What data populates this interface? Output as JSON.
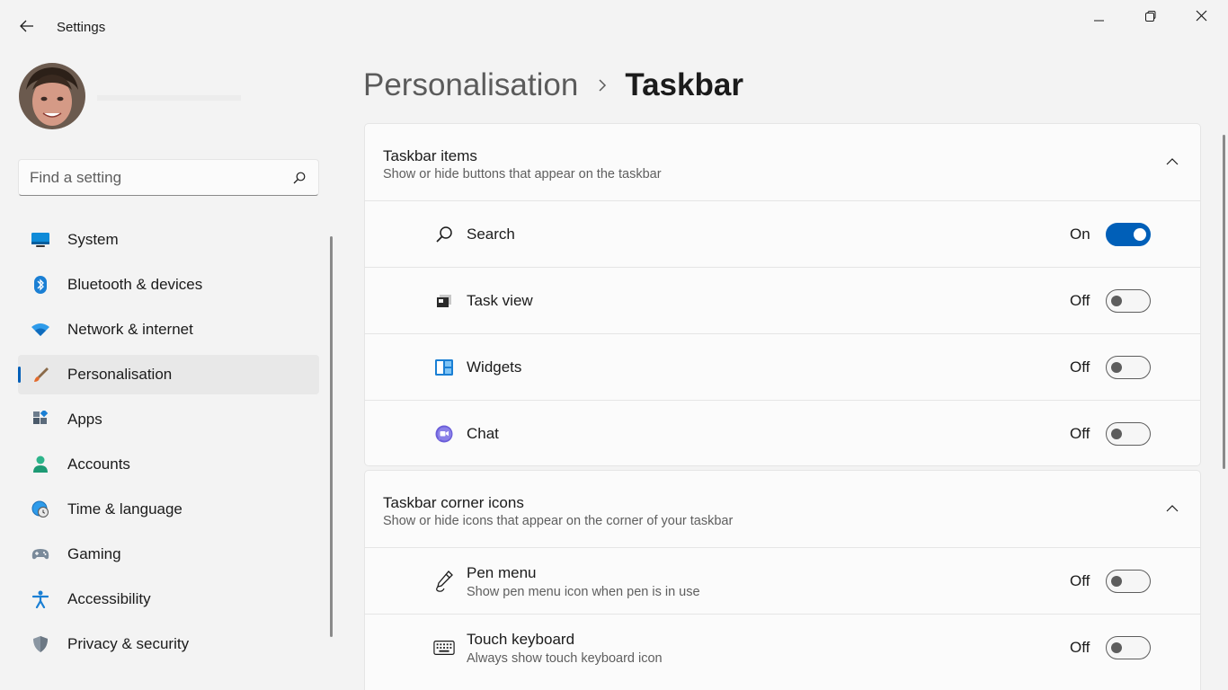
{
  "window": {
    "title": "Settings",
    "back_icon": "back-arrow-icon",
    "minimize_icon": "minimize-icon",
    "maximize_icon": "restore-icon",
    "close_icon": "close-icon"
  },
  "search": {
    "placeholder": "Find a setting",
    "value": "",
    "icon": "search-icon"
  },
  "sidebar": {
    "items": [
      {
        "label": "System",
        "icon": "system-icon",
        "active": false
      },
      {
        "label": "Bluetooth & devices",
        "icon": "bluetooth-icon",
        "active": false
      },
      {
        "label": "Network & internet",
        "icon": "wifi-icon",
        "active": false
      },
      {
        "label": "Personalisation",
        "icon": "paintbrush-icon",
        "active": true
      },
      {
        "label": "Apps",
        "icon": "apps-icon",
        "active": false
      },
      {
        "label": "Accounts",
        "icon": "accounts-icon",
        "active": false
      },
      {
        "label": "Time & language",
        "icon": "globe-clock-icon",
        "active": false
      },
      {
        "label": "Gaming",
        "icon": "gamepad-icon",
        "active": false
      },
      {
        "label": "Accessibility",
        "icon": "accessibility-icon",
        "active": false
      },
      {
        "label": "Privacy & security",
        "icon": "shield-icon",
        "active": false
      }
    ]
  },
  "header": {
    "parent": "Personalisation",
    "current": "Taskbar"
  },
  "sections": [
    {
      "title": "Taskbar items",
      "subtitle": "Show or hide buttons that appear on the taskbar",
      "expanded": true,
      "rows": [
        {
          "label": "Search",
          "state": "On",
          "icon": "search-icon"
        },
        {
          "label": "Task view",
          "state": "Off",
          "icon": "task-view-icon"
        },
        {
          "label": "Widgets",
          "state": "Off",
          "icon": "widgets-icon"
        },
        {
          "label": "Chat",
          "state": "Off",
          "icon": "chat-icon"
        }
      ]
    },
    {
      "title": "Taskbar corner icons",
      "subtitle": "Show or hide icons that appear on the corner of your taskbar",
      "expanded": true,
      "rows": [
        {
          "label": "Pen menu",
          "description": "Show pen menu icon when pen is in use",
          "state": "Off",
          "icon": "pen-icon"
        },
        {
          "label": "Touch keyboard",
          "description": "Always show touch keyboard icon",
          "state": "Off",
          "icon": "keyboard-icon"
        }
      ]
    }
  ],
  "colors": {
    "accent": "#005fb8",
    "background": "#f3f3f3",
    "card": "#fbfbfb"
  }
}
